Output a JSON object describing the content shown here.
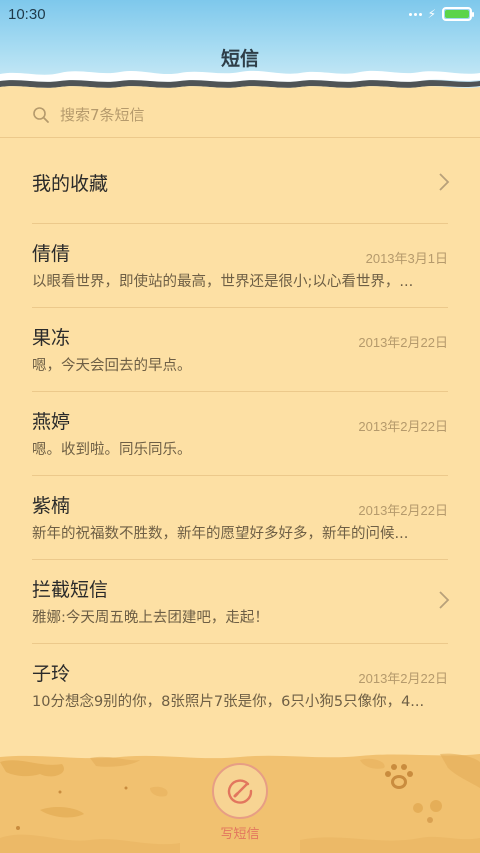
{
  "status_bar": {
    "time": "10:30"
  },
  "header": {
    "title": "短信"
  },
  "search": {
    "placeholder": "搜索7条短信"
  },
  "favorites": {
    "label": "我的收藏"
  },
  "messages": [
    {
      "name": "倩倩",
      "date": "2013年3月1日",
      "preview": "以眼看世界，即使站的最高，世界还是很小;以心看世界，..."
    },
    {
      "name": "果冻",
      "date": "2013年2月22日",
      "preview": "嗯，今天会回去的早点。"
    },
    {
      "name": "燕婷",
      "date": "2013年2月22日",
      "preview": "嗯。收到啦。同乐同乐。"
    },
    {
      "name": "紫楠",
      "date": "2013年2月22日",
      "preview": "新年的祝福数不胜数，新年的愿望好多好多，新年的问候..."
    },
    {
      "name": "拦截短信",
      "date": "",
      "preview": "雅娜:今天周五晚上去团建吧，走起！"
    },
    {
      "name": "子玲",
      "date": "2013年2月22日",
      "preview": "10分想念9别的你，8张照片7张是你，6只小狗5只像你，4..."
    }
  ],
  "compose": {
    "label": "写短信"
  },
  "battery": {
    "level": 1.0
  },
  "colors": {
    "accent": "#e2765e",
    "background": "#fde0a4",
    "sand": "#f1c170",
    "sky": "#7ec8ec",
    "battery": "#5cd44a"
  },
  "icons": {
    "search": "search-icon",
    "chevron": "chevron-right-icon",
    "compose": "compose-icon",
    "paw": "paw-print-icon"
  }
}
